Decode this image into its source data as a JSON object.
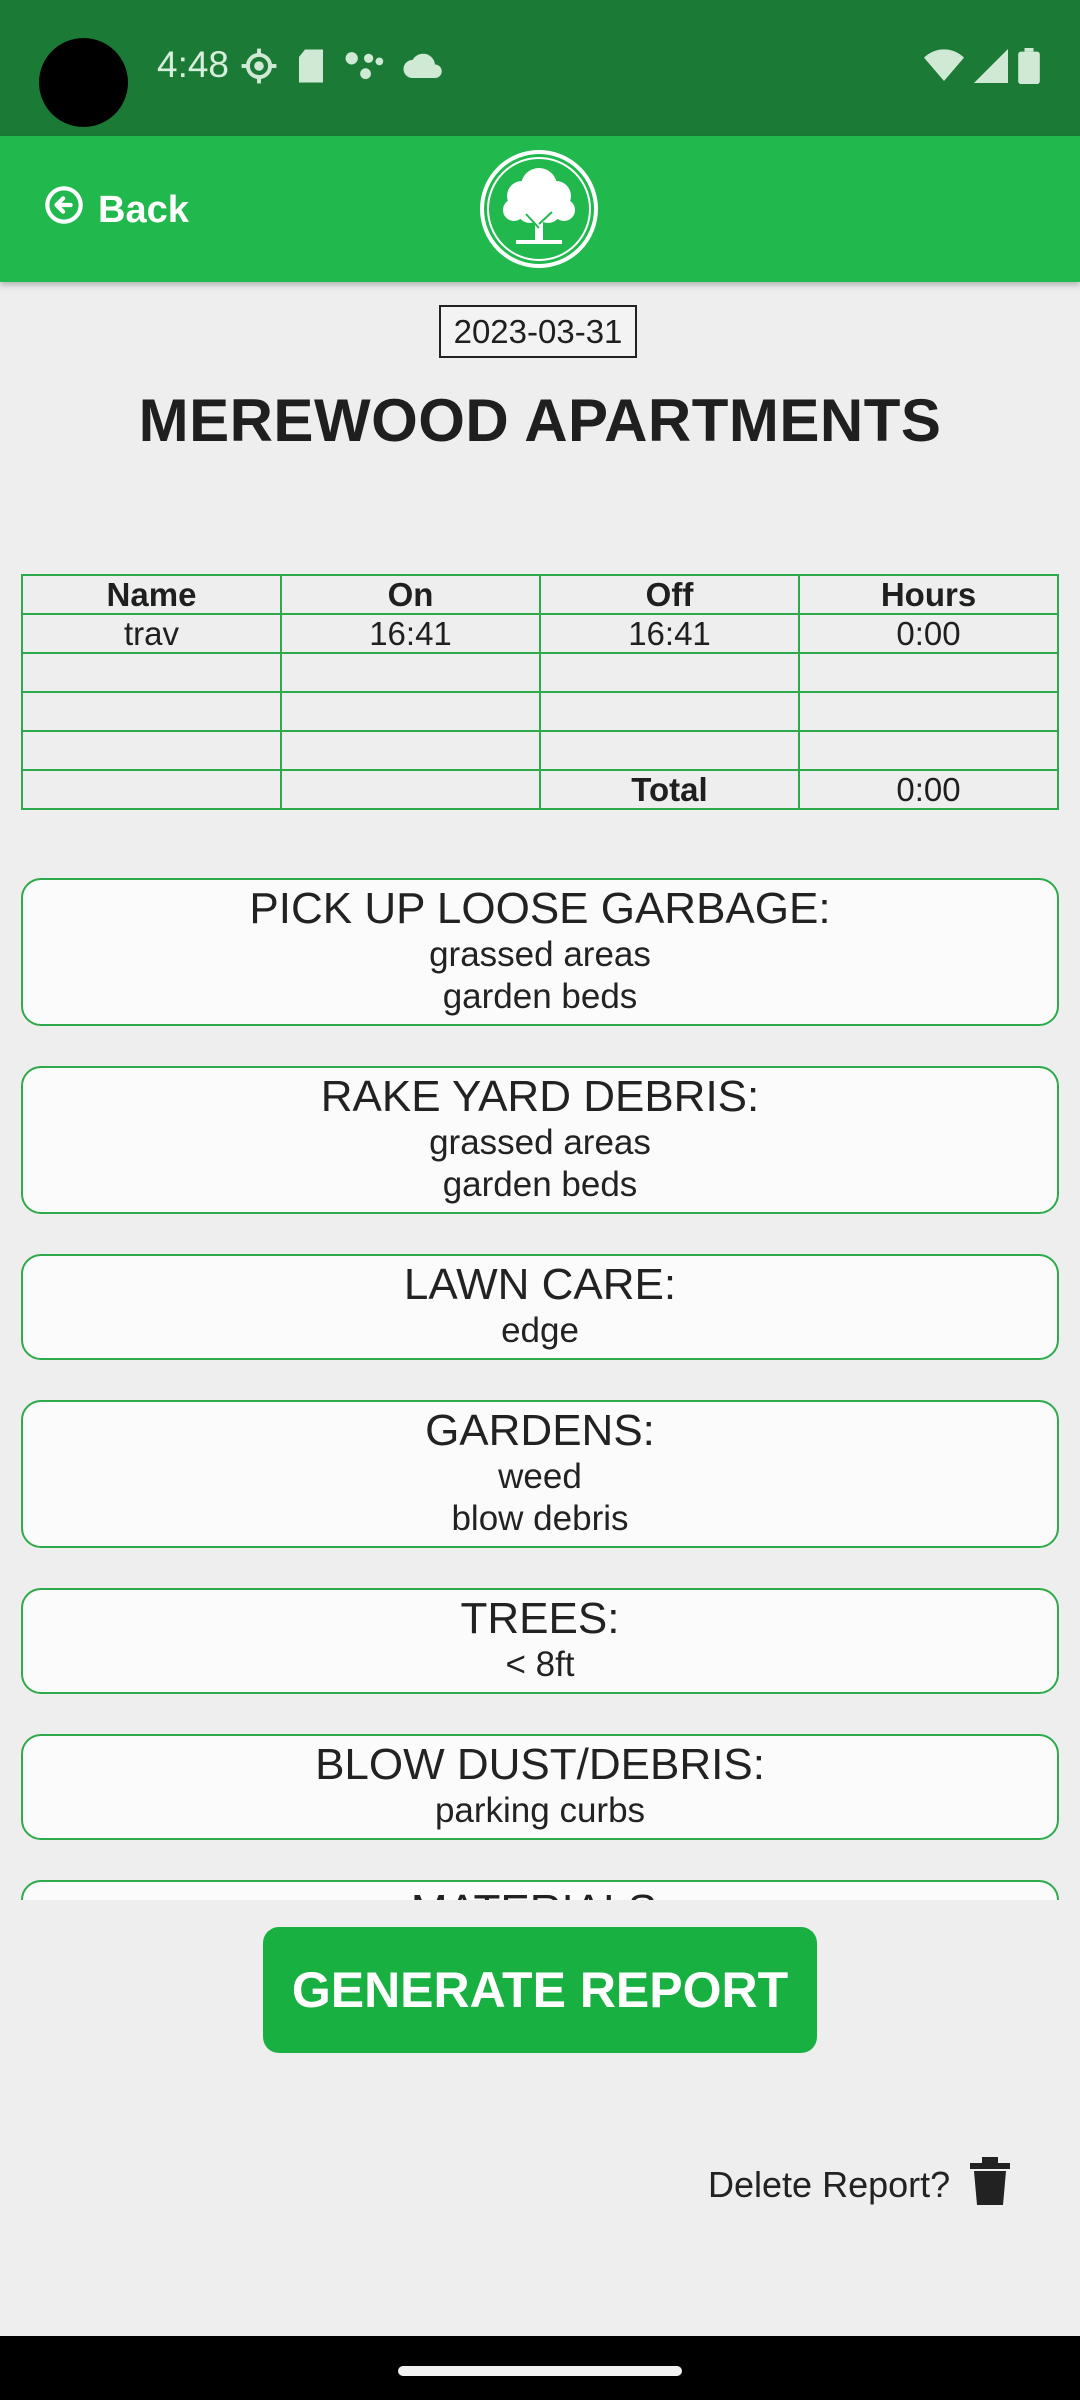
{
  "status_bar": {
    "time": "4:48",
    "left_icons": [
      "settings-icon",
      "sd-card-icon",
      "assistant-dots-icon",
      "cloud-icon"
    ],
    "right_icons": [
      "wifi-icon",
      "signal-icon",
      "battery-icon"
    ]
  },
  "app_bar": {
    "back_label": "Back",
    "logo": "tree-logo-icon"
  },
  "report": {
    "date": "2023-03-31",
    "title": "MEREWOOD APARTMENTS"
  },
  "timesheet": {
    "headers": [
      "Name",
      "On",
      "Off",
      "Hours"
    ],
    "rows": [
      [
        "trav",
        "16:41",
        "16:41",
        "0:00"
      ],
      [
        "",
        "",
        "",
        ""
      ],
      [
        "",
        "",
        "",
        ""
      ],
      [
        "",
        "",
        "",
        ""
      ]
    ],
    "total_label": "Total",
    "total_value": "0:00"
  },
  "tasks": [
    {
      "title": "PICK UP LOOSE GARBAGE:",
      "items": [
        "grassed areas",
        "garden beds"
      ]
    },
    {
      "title": "RAKE YARD DEBRIS:",
      "items": [
        "grassed areas",
        "garden beds"
      ]
    },
    {
      "title": "LAWN CARE:",
      "items": [
        "edge"
      ]
    },
    {
      "title": "GARDENS:",
      "items": [
        "weed",
        "blow debris"
      ]
    },
    {
      "title": "TREES:",
      "items": [
        "< 8ft"
      ]
    },
    {
      "title": "BLOW DUST/DEBRIS:",
      "items": [
        "parking curbs"
      ]
    },
    {
      "title": "MATERIALS:",
      "items": []
    }
  ],
  "actions": {
    "generate_label": "GENERATE REPORT",
    "delete_label": "Delete Report?"
  },
  "colors": {
    "status_bar": "#1b7a36",
    "app_bar": "#21b94d",
    "accent": "#19b042",
    "border": "#2eaa4a"
  }
}
